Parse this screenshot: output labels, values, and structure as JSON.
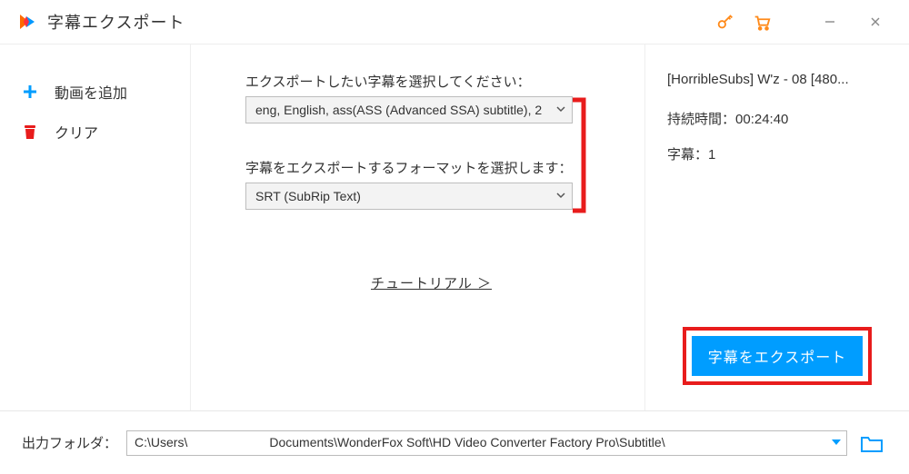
{
  "window": {
    "title": "字幕エクスポート"
  },
  "sidebar": {
    "add_video": "動画を追加",
    "clear": "クリア"
  },
  "center": {
    "select_subtitle_label": "エクスポートしたい字幕を選択してください：",
    "subtitle_value": "eng, English, ass(ASS (Advanced SSA) subtitle), 2",
    "select_format_label": "字幕をエクスポートするフォーマットを選択します：",
    "format_value": "SRT (SubRip Text)",
    "tutorial": "チュートリアル ＞"
  },
  "right": {
    "file_title": "[HorribleSubs] W'z - 08 [480...",
    "duration_label": "持続時間：",
    "duration_value": "00:24:40",
    "sub_count_label": "字幕：",
    "sub_count_value": "1",
    "export_button": "字幕をエクスポート"
  },
  "footer": {
    "output_folder_label": "出力フォルダ：",
    "path_prefix": "C:\\Users\\",
    "path_suffix": "Documents\\WonderFox Soft\\HD Video Converter Factory Pro\\Subtitle\\"
  }
}
